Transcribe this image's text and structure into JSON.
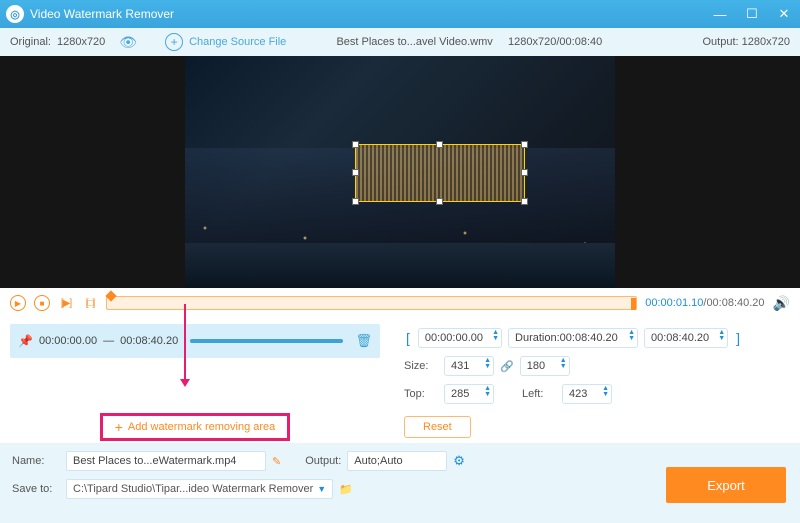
{
  "titlebar": {
    "title": "Video Watermark Remover"
  },
  "toolbar": {
    "original_label": "Original:",
    "original_res": "1280x720",
    "change_source": "Change Source File",
    "filename": "Best Places to...avel Video.wmv",
    "file_res_time": "1280x720/00:08:40",
    "output_label": "Output:",
    "output_res": "1280x720"
  },
  "playbar": {
    "current": "00:00:01.10",
    "duration": "00:08:40.20"
  },
  "segment": {
    "start": "00:00:00.00",
    "sep": "—",
    "end": "00:08:40.20"
  },
  "controls": {
    "time_start": "00:00:00.00",
    "dur_label": "Duration:",
    "dur_value": "00:08:40.20",
    "time_end": "00:08:40.20",
    "size_label": "Size:",
    "width": "431",
    "height": "180",
    "top_label": "Top:",
    "top": "285",
    "left_label": "Left:",
    "left": "423",
    "reset": "Reset"
  },
  "add_area": "Add watermark removing area",
  "bottom": {
    "name_label": "Name:",
    "name_value": "Best Places to...eWatermark.mp4",
    "output_label": "Output:",
    "output_value": "Auto;Auto",
    "saveto_label": "Save to:",
    "saveto_value": "C:\\Tipard Studio\\Tipar...ideo Watermark Remover",
    "export": "Export"
  }
}
